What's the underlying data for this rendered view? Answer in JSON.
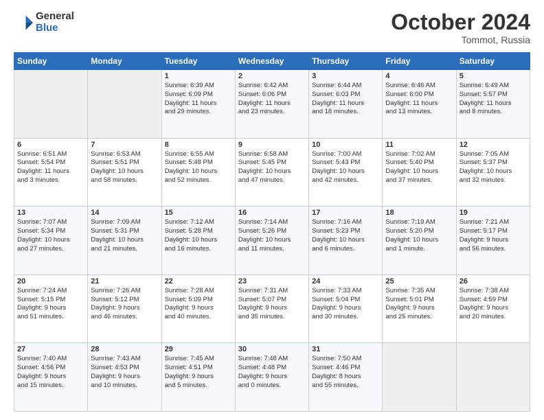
{
  "header": {
    "logo_line1": "General",
    "logo_line2": "Blue",
    "month": "October 2024",
    "location": "Tommot, Russia"
  },
  "weekdays": [
    "Sunday",
    "Monday",
    "Tuesday",
    "Wednesday",
    "Thursday",
    "Friday",
    "Saturday"
  ],
  "weeks": [
    [
      {
        "day": "",
        "detail": ""
      },
      {
        "day": "",
        "detail": ""
      },
      {
        "day": "1",
        "detail": "Sunrise: 6:39 AM\nSunset: 6:09 PM\nDaylight: 11 hours\nand 29 minutes."
      },
      {
        "day": "2",
        "detail": "Sunrise: 6:42 AM\nSunset: 6:06 PM\nDaylight: 11 hours\nand 23 minutes."
      },
      {
        "day": "3",
        "detail": "Sunrise: 6:44 AM\nSunset: 6:03 PM\nDaylight: 11 hours\nand 18 minutes."
      },
      {
        "day": "4",
        "detail": "Sunrise: 6:46 AM\nSunset: 6:00 PM\nDaylight: 11 hours\nand 13 minutes."
      },
      {
        "day": "5",
        "detail": "Sunrise: 6:49 AM\nSunset: 5:57 PM\nDaylight: 11 hours\nand 8 minutes."
      }
    ],
    [
      {
        "day": "6",
        "detail": "Sunrise: 6:51 AM\nSunset: 5:54 PM\nDaylight: 11 hours\nand 3 minutes."
      },
      {
        "day": "7",
        "detail": "Sunrise: 6:53 AM\nSunset: 5:51 PM\nDaylight: 10 hours\nand 58 minutes."
      },
      {
        "day": "8",
        "detail": "Sunrise: 6:55 AM\nSunset: 5:48 PM\nDaylight: 10 hours\nand 52 minutes."
      },
      {
        "day": "9",
        "detail": "Sunrise: 6:58 AM\nSunset: 5:45 PM\nDaylight: 10 hours\nand 47 minutes."
      },
      {
        "day": "10",
        "detail": "Sunrise: 7:00 AM\nSunset: 5:43 PM\nDaylight: 10 hours\nand 42 minutes."
      },
      {
        "day": "11",
        "detail": "Sunrise: 7:02 AM\nSunset: 5:40 PM\nDaylight: 10 hours\nand 37 minutes."
      },
      {
        "day": "12",
        "detail": "Sunrise: 7:05 AM\nSunset: 5:37 PM\nDaylight: 10 hours\nand 32 minutes."
      }
    ],
    [
      {
        "day": "13",
        "detail": "Sunrise: 7:07 AM\nSunset: 5:34 PM\nDaylight: 10 hours\nand 27 minutes."
      },
      {
        "day": "14",
        "detail": "Sunrise: 7:09 AM\nSunset: 5:31 PM\nDaylight: 10 hours\nand 21 minutes."
      },
      {
        "day": "15",
        "detail": "Sunrise: 7:12 AM\nSunset: 5:28 PM\nDaylight: 10 hours\nand 16 minutes."
      },
      {
        "day": "16",
        "detail": "Sunrise: 7:14 AM\nSunset: 5:26 PM\nDaylight: 10 hours\nand 11 minutes."
      },
      {
        "day": "17",
        "detail": "Sunrise: 7:16 AM\nSunset: 5:23 PM\nDaylight: 10 hours\nand 6 minutes."
      },
      {
        "day": "18",
        "detail": "Sunrise: 7:19 AM\nSunset: 5:20 PM\nDaylight: 10 hours\nand 1 minute."
      },
      {
        "day": "19",
        "detail": "Sunrise: 7:21 AM\nSunset: 5:17 PM\nDaylight: 9 hours\nand 56 minutes."
      }
    ],
    [
      {
        "day": "20",
        "detail": "Sunrise: 7:24 AM\nSunset: 5:15 PM\nDaylight: 9 hours\nand 51 minutes."
      },
      {
        "day": "21",
        "detail": "Sunrise: 7:26 AM\nSunset: 5:12 PM\nDaylight: 9 hours\nand 46 minutes."
      },
      {
        "day": "22",
        "detail": "Sunrise: 7:28 AM\nSunset: 5:09 PM\nDaylight: 9 hours\nand 40 minutes."
      },
      {
        "day": "23",
        "detail": "Sunrise: 7:31 AM\nSunset: 5:07 PM\nDaylight: 9 hours\nand 35 minutes."
      },
      {
        "day": "24",
        "detail": "Sunrise: 7:33 AM\nSunset: 5:04 PM\nDaylight: 9 hours\nand 30 minutes."
      },
      {
        "day": "25",
        "detail": "Sunrise: 7:35 AM\nSunset: 5:01 PM\nDaylight: 9 hours\nand 25 minutes."
      },
      {
        "day": "26",
        "detail": "Sunrise: 7:38 AM\nSunset: 4:59 PM\nDaylight: 9 hours\nand 20 minutes."
      }
    ],
    [
      {
        "day": "27",
        "detail": "Sunrise: 7:40 AM\nSunset: 4:56 PM\nDaylight: 9 hours\nand 15 minutes."
      },
      {
        "day": "28",
        "detail": "Sunrise: 7:43 AM\nSunset: 4:53 PM\nDaylight: 9 hours\nand 10 minutes."
      },
      {
        "day": "29",
        "detail": "Sunrise: 7:45 AM\nSunset: 4:51 PM\nDaylight: 9 hours\nand 5 minutes."
      },
      {
        "day": "30",
        "detail": "Sunrise: 7:48 AM\nSunset: 4:48 PM\nDaylight: 9 hours\nand 0 minutes."
      },
      {
        "day": "31",
        "detail": "Sunrise: 7:50 AM\nSunset: 4:46 PM\nDaylight: 8 hours\nand 55 minutes."
      },
      {
        "day": "",
        "detail": ""
      },
      {
        "day": "",
        "detail": ""
      }
    ]
  ]
}
